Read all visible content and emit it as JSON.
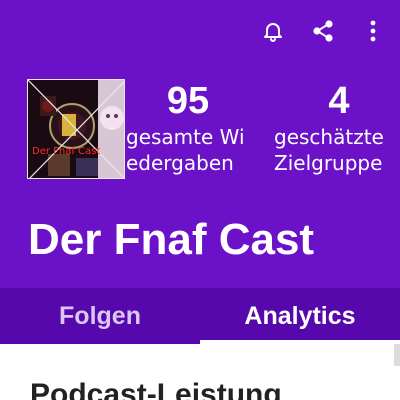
{
  "toolbar": {
    "notifications_icon": "bell-icon",
    "share_icon": "share-icon",
    "more_icon": "more-vertical-icon"
  },
  "podcast": {
    "cover_text": "Der Fnaf Cast",
    "title": "Der Fnaf Cast"
  },
  "stats": [
    {
      "value": "95",
      "label_line1": "gesamte Wi",
      "label_line2": "edergaben"
    },
    {
      "value": "4",
      "label_line1": "geschätzte",
      "label_line2": "Zielgruppe"
    }
  ],
  "tabs": [
    {
      "label": "Folgen",
      "active": false
    },
    {
      "label": "Analytics",
      "active": true
    }
  ],
  "main": {
    "section_title": "Podcast-Leistung"
  },
  "colors": {
    "primary": "#6b12c9",
    "tab_bar": "#5608ad",
    "text_light": "#ffffff"
  }
}
